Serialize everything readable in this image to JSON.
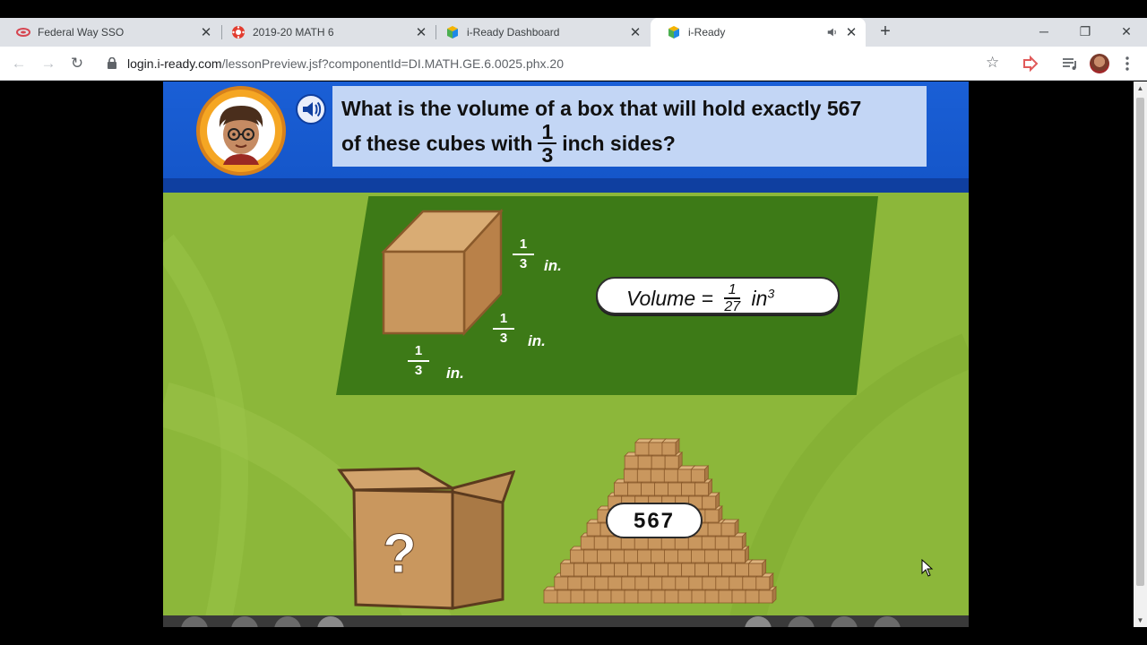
{
  "browser": {
    "tabs": [
      {
        "title": "Federal Way SSO",
        "close": "✕"
      },
      {
        "title": "2019-20 MATH 6",
        "close": "✕"
      },
      {
        "title": "i-Ready Dashboard",
        "close": "✕"
      },
      {
        "title": "i-Ready",
        "close": "✕",
        "active": true
      }
    ],
    "new_tab": "+",
    "window": {
      "minimize": "─",
      "restore": "❐",
      "close": "✕"
    },
    "nav": {
      "back": "←",
      "forward": "→",
      "reload": "↻"
    },
    "url": {
      "host": "login.i-ready.com",
      "path": "/lessonPreview.jsf?componentId=DI.MATH.GE.6.0025.phx.20"
    },
    "bookmark": "☆"
  },
  "lesson": {
    "question_line1": "What is the volume of a box that will hold exactly 567",
    "question_line2_pre": "of these cubes with",
    "question_frac_num": "1",
    "question_frac_den": "3",
    "question_line2_post": "inch sides?",
    "volume_prefix": "Volume =",
    "volume_frac_num": "1",
    "volume_frac_den": "27",
    "volume_unit": "in",
    "volume_exp": "3",
    "edge_num": "1",
    "edge_den": "3",
    "edge_unit": "in.",
    "box_mark": "?",
    "cube_count": "567"
  },
  "colors": {
    "banner": "#1a5fd6",
    "question_box": "#c3d6f5",
    "panel": "#3d7a17",
    "background": "#8cb73a",
    "cube": "#c9975e"
  }
}
